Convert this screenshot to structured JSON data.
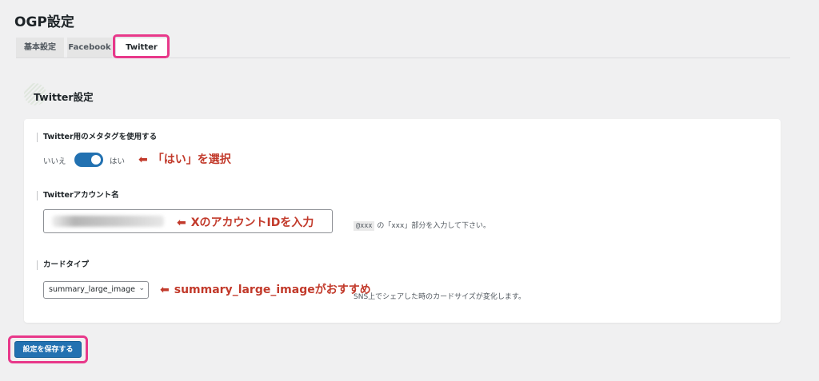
{
  "page": {
    "title": "OGP設定"
  },
  "tabs": [
    {
      "label": "基本設定"
    },
    {
      "label": "Facebook"
    },
    {
      "label": "Twitter"
    }
  ],
  "section": {
    "title": "Twitter設定"
  },
  "fields": {
    "meta_tag": {
      "label": "Twitter用のメタタグを使用する",
      "off_label": "いいえ",
      "on_label": "はい",
      "enabled": true
    },
    "account": {
      "label": "Twitterアカウント名",
      "help_code": "@xxx",
      "help_text": " の「xxx」部分を入力して下さい。"
    },
    "card_type": {
      "label": "カードタイプ",
      "selected": "summary_large_image",
      "help_text": "SNS上でシェアした時のカードサイズが変化します。"
    }
  },
  "annotations": {
    "toggle": "「はい」を選択",
    "account": "XのアカウントIDを入力",
    "card_type": "summary_large_imageがおすすめ"
  },
  "icons": {
    "arrow": "left-arrow-icon",
    "dropdown": "chevron-down-icon"
  },
  "colors": {
    "accent": "#2271b1",
    "highlight": "#e8388a",
    "annotation": "#c23a2b"
  },
  "save_button": {
    "label": "設定を保存する"
  }
}
